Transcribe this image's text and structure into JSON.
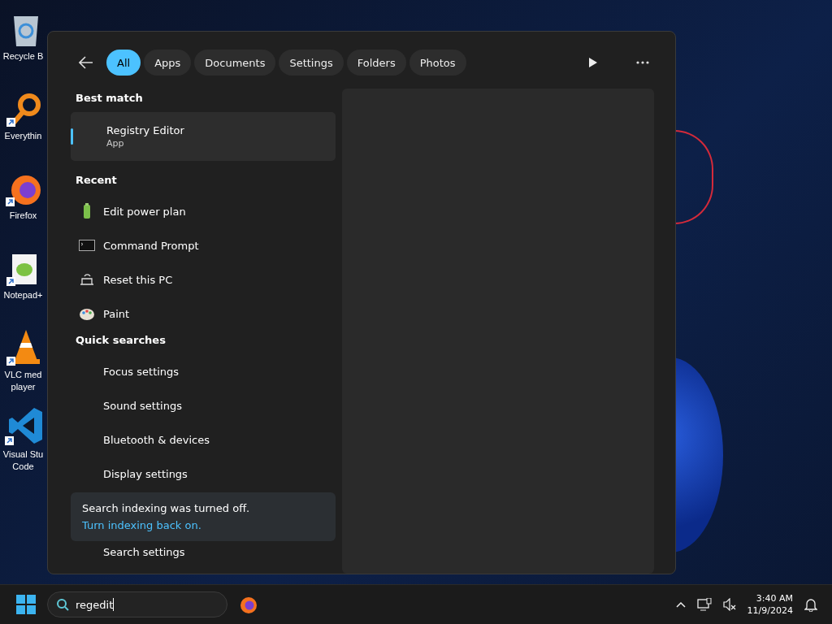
{
  "desktop_icons": [
    {
      "label": "Recycle B",
      "kind": "bin",
      "shortcut": false
    },
    {
      "label": "Everythin",
      "kind": "search",
      "shortcut": true
    },
    {
      "label": "Firefox",
      "kind": "firefox",
      "shortcut": true
    },
    {
      "label": "Notepad+",
      "kind": "notepad",
      "shortcut": true
    },
    {
      "label": "VLC med player",
      "kind": "cone",
      "shortcut": true
    },
    {
      "label": "Visual Stu Code",
      "kind": "vscode",
      "shortcut": true
    }
  ],
  "search_panel": {
    "filters": [
      {
        "label": "All",
        "selected": true
      },
      {
        "label": "Apps",
        "selected": false
      },
      {
        "label": "Documents",
        "selected": false
      },
      {
        "label": "Settings",
        "selected": false
      },
      {
        "label": "Folders",
        "selected": false
      },
      {
        "label": "Photos",
        "selected": false
      }
    ],
    "best_match": {
      "heading": "Best match",
      "title": "Registry Editor",
      "subtitle": "App"
    },
    "recent": {
      "heading": "Recent",
      "items": [
        {
          "label": "Edit power plan",
          "kind": "battery"
        },
        {
          "label": "Command Prompt",
          "kind": "terminal"
        },
        {
          "label": "Reset this PC",
          "kind": "reset"
        },
        {
          "label": "Paint",
          "kind": "palette"
        }
      ]
    },
    "quick_searches": {
      "heading": "Quick searches",
      "items": [
        {
          "label": "Focus settings"
        },
        {
          "label": "Sound settings"
        },
        {
          "label": "Bluetooth & devices"
        },
        {
          "label": "Display settings"
        }
      ]
    },
    "notice": {
      "text": "Search indexing was turned off.",
      "link": "Turn indexing back on."
    },
    "last_item": "Search settings"
  },
  "taskbar": {
    "search_value": "regedit",
    "time": "3:40 AM",
    "date": "11/9/2024"
  }
}
